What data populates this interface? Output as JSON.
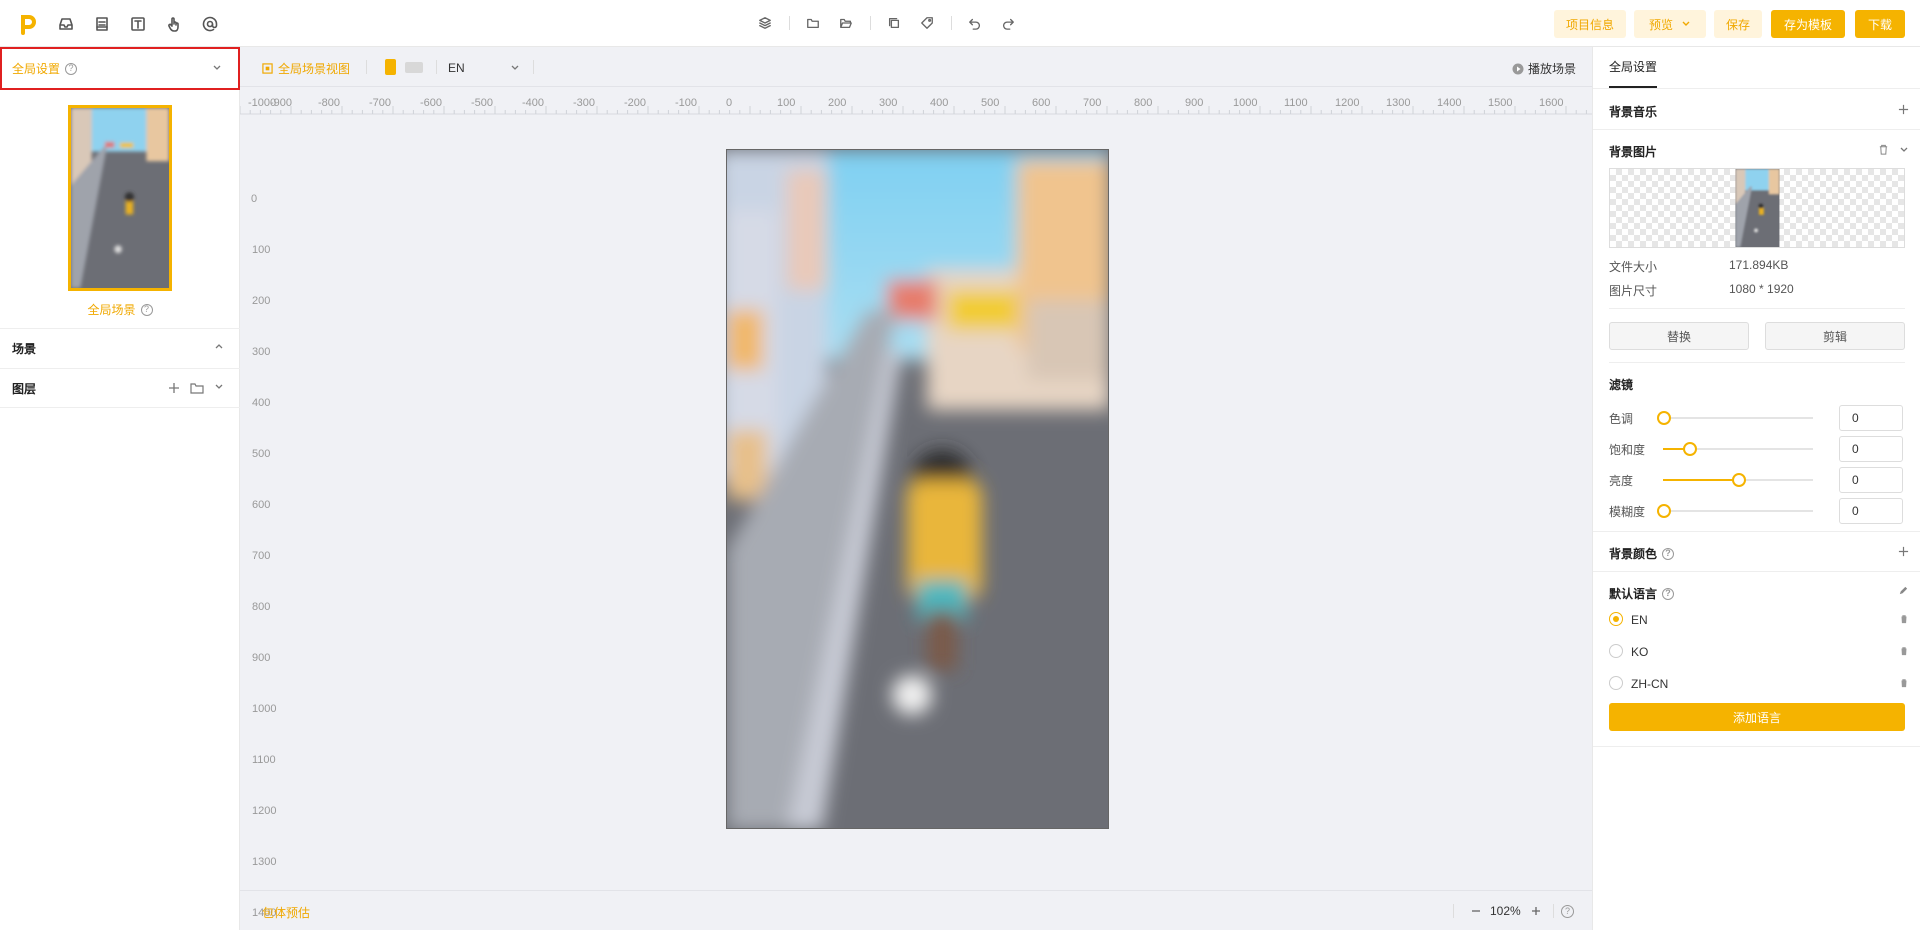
{
  "topbar": {
    "left_icons": [
      "inbox-icon",
      "document-icon",
      "text-icon",
      "touch-icon",
      "at-icon"
    ],
    "center_icons": [
      "layers-icon",
      "folder-icon",
      "folder-open-icon",
      "copy-icon",
      "tag-icon",
      "undo-icon",
      "redo-icon"
    ],
    "project_info": "项目信息",
    "preview": "预览",
    "save": "保存",
    "save_template": "存为模板",
    "download": "下载",
    "brand_color": "#f5b300"
  },
  "left": {
    "global_settings": "全局设置",
    "global_scene": "全局场景",
    "scenes": "场景",
    "layers": "图层"
  },
  "canvas": {
    "global_view": "全局场景视图",
    "language": "EN",
    "play_scene": "播放场景",
    "ruler_x": [
      "-1000",
      "-900",
      "-800",
      "-700",
      "-600",
      "-500",
      "-400",
      "-300",
      "-200",
      "-100",
      "0",
      "100",
      "200",
      "300",
      "400",
      "500",
      "600",
      "700",
      "800",
      "900",
      "1000",
      "1100",
      "1200",
      "1300",
      "1400",
      "1500",
      "1600"
    ],
    "ruler_y": [
      "0",
      "100",
      "200",
      "300",
      "400",
      "500",
      "600",
      "700",
      "800",
      "900",
      "1000",
      "1100",
      "1200",
      "1300",
      "1400"
    ],
    "bundle_estimate": "包体预估",
    "zoom": "102%"
  },
  "right": {
    "tab": "全局设置",
    "bg_music": "背景音乐",
    "bg_image": "背景图片",
    "file_size_label": "文件大小",
    "file_size": "171.894KB",
    "image_size_label": "图片尺寸",
    "image_size": "1080 * 1920",
    "replace": "替换",
    "crop": "剪辑",
    "filter": "滤镜",
    "filters": [
      {
        "label": "色调",
        "value": "0",
        "level": 0
      },
      {
        "label": "饱和度",
        "value": "0",
        "level": 0.17
      },
      {
        "label": "亮度",
        "value": "0",
        "level": 0.5
      },
      {
        "label": "模糊度",
        "value": "0",
        "level": 0
      }
    ],
    "bg_color": "背景颜色",
    "default_language": "默认语言",
    "languages": [
      {
        "code": "EN",
        "selected": true
      },
      {
        "code": "KO",
        "selected": false
      },
      {
        "code": "ZH-CN",
        "selected": false
      }
    ],
    "add_language": "添加语言"
  }
}
